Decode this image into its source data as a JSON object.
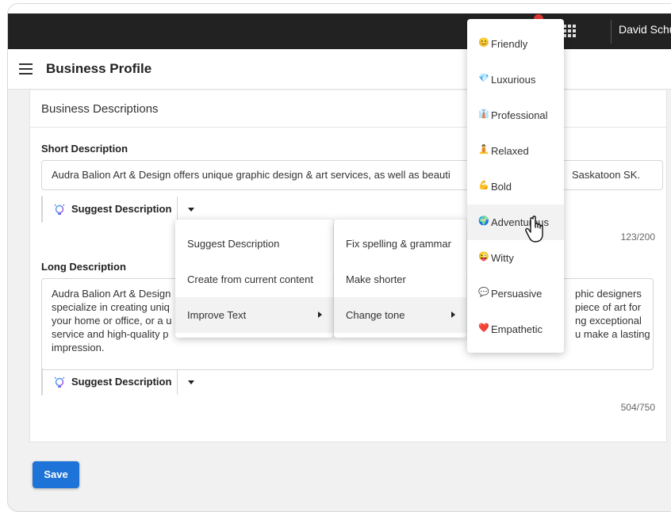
{
  "topbar": {
    "user_name": "David Schul",
    "notification_count": ""
  },
  "header": {
    "title": "Business Profile"
  },
  "card": {
    "title": "Business Descriptions",
    "short_label": "Short Description",
    "short_value": "Audra Balion Art & Design offers unique graphic design & art services, as well as beauti",
    "short_value_tail": "Saskatoon SK.",
    "short_counter": "123/200",
    "long_label": "Long Description",
    "long_lines_left": [
      "Audra Balion Art & Design",
      "specialize in creating uniq",
      "your home or office, or a u",
      "service and high-quality p",
      "impression."
    ],
    "long_lines_right": [
      "phic designers",
      "piece of art for",
      "ng exceptional",
      "u make a lasting"
    ],
    "long_counter": "504/750",
    "suggest_label": "Suggest Description"
  },
  "save_label": "Save",
  "menu1": {
    "items": [
      "Suggest Description",
      "Create from current content",
      "Improve Text"
    ]
  },
  "menu2": {
    "items": [
      "Fix spelling & grammar",
      "Make shorter",
      "Change tone"
    ]
  },
  "tones": [
    {
      "emoji": "😊",
      "label": "Friendly"
    },
    {
      "emoji": "💎",
      "label": "Luxurious"
    },
    {
      "emoji": "👔",
      "label": "Professional"
    },
    {
      "emoji": "🧘",
      "label": "Relaxed"
    },
    {
      "emoji": "💪",
      "label": "Bold"
    },
    {
      "emoji": "🌍",
      "label": "Adventurous"
    },
    {
      "emoji": "😜",
      "label": "Witty"
    },
    {
      "emoji": "💬",
      "label": "Persuasive"
    },
    {
      "emoji": "❤️",
      "label": "Empathetic"
    }
  ],
  "colors": {
    "topbar": "#222222",
    "primary": "#1e73d8",
    "notification": "#e53935"
  }
}
